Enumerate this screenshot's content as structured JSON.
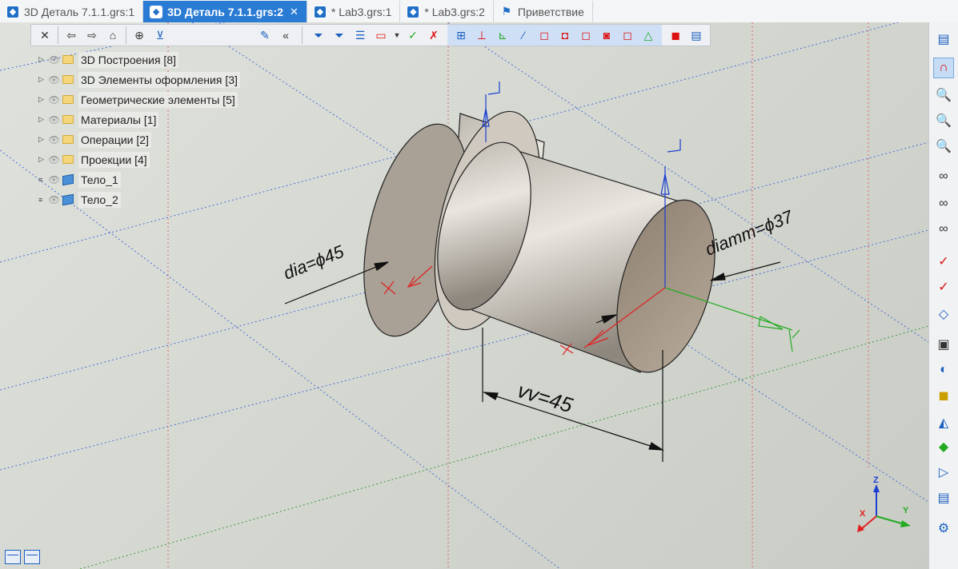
{
  "tabs": [
    {
      "label": "3D Деталь 7.1.1.grs:1",
      "active": false
    },
    {
      "label": "3D Деталь 7.1.1.grs:2",
      "active": true,
      "close": "✕"
    },
    {
      "label": "* Lab3.grs:1",
      "active": false
    },
    {
      "label": "* Lab3.grs:2",
      "active": false
    },
    {
      "label": "Приветствие",
      "active": false,
      "icon": "flag-icon"
    }
  ],
  "toolbar": {
    "close": "✕",
    "back": "⇦",
    "forward": "⇨",
    "home": "⌂",
    "collapse": "«"
  },
  "tree": [
    {
      "label": "3D Построения [8]",
      "type": "folder"
    },
    {
      "label": "3D Элементы оформления [3]",
      "type": "folder"
    },
    {
      "label": "Геометрические элементы [5]",
      "type": "folder"
    },
    {
      "label": "Материалы [1]",
      "type": "folder"
    },
    {
      "label": "Операции [2]",
      "type": "folder"
    },
    {
      "label": "Проекции [4]",
      "type": "folder"
    },
    {
      "label": "Тело_1",
      "type": "body"
    },
    {
      "label": "Тело_2",
      "type": "body"
    }
  ],
  "dimensions": {
    "dia": "dia=ϕ45",
    "diamm": "diamm=ϕ37",
    "vv": "vv=45"
  },
  "axes": {
    "x": "X",
    "y": "Y",
    "z": "Z"
  },
  "colors": {
    "accent": "#2a7bd4",
    "axis_x": "#e02020",
    "axis_y": "#22aa22",
    "axis_z": "#1a3fd0"
  }
}
